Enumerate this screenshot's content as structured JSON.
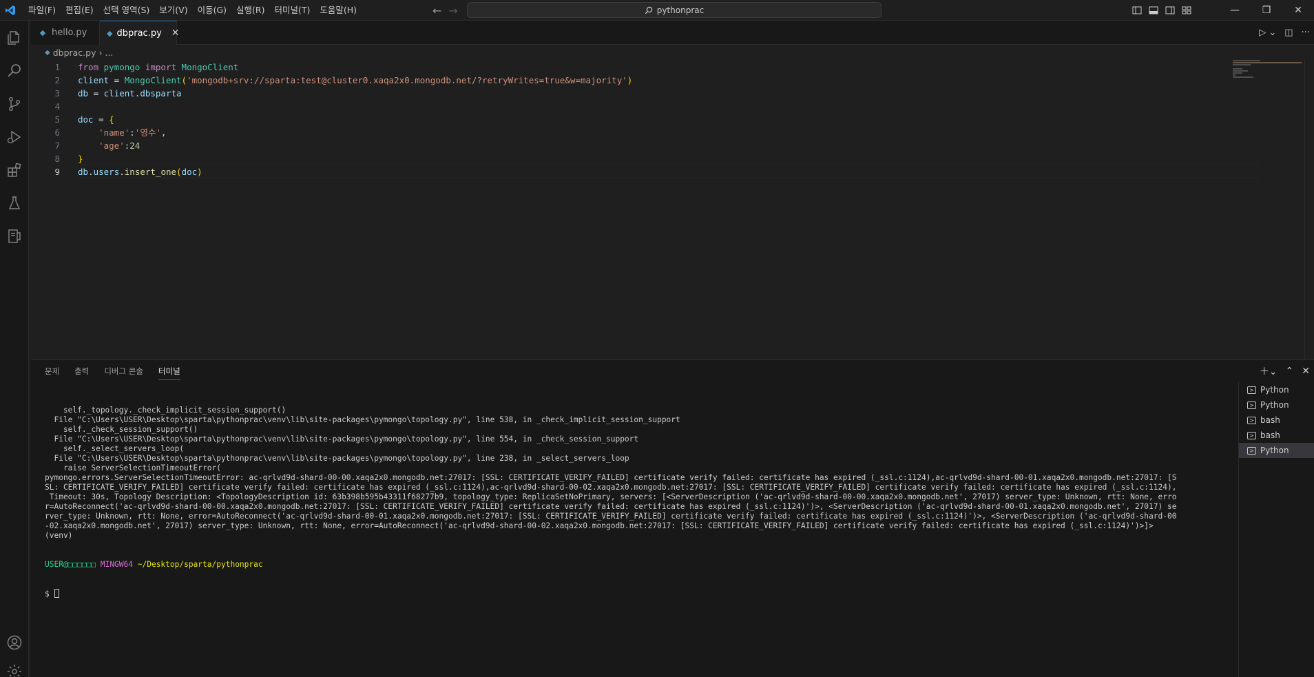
{
  "menu": [
    "파일(F)",
    "편집(E)",
    "선택 영역(S)",
    "보기(V)",
    "이동(G)",
    "실행(R)",
    "터미널(T)",
    "도움말(H)"
  ],
  "search": {
    "text": "pythonprac"
  },
  "tabs": [
    {
      "label": "hello.py",
      "active": false
    },
    {
      "label": "dbprac.py",
      "active": true
    }
  ],
  "breadcrumb": {
    "file": "dbprac.py",
    "rest": "..."
  },
  "editor": {
    "line_numbers": [
      "1",
      "2",
      "3",
      "4",
      "5",
      "6",
      "7",
      "8",
      "9"
    ],
    "lines": [
      [
        {
          "t": "from",
          "c": "kw"
        },
        {
          "t": " "
        },
        {
          "t": "pymongo",
          "c": "mod"
        },
        {
          "t": " "
        },
        {
          "t": "import",
          "c": "kw"
        },
        {
          "t": " "
        },
        {
          "t": "MongoClient",
          "c": "mod"
        }
      ],
      [
        {
          "t": "client",
          "c": "var"
        },
        {
          "t": " = ",
          "c": "op"
        },
        {
          "t": "MongoClient",
          "c": "mod"
        },
        {
          "t": "(",
          "c": "br1"
        },
        {
          "t": "'mongodb+srv://sparta:test@cluster0.xaqa2x0.mongodb.net/?retryWrites=true&w=majority'",
          "c": "str"
        },
        {
          "t": ")",
          "c": "br1"
        }
      ],
      [
        {
          "t": "db",
          "c": "var"
        },
        {
          "t": " = ",
          "c": "op"
        },
        {
          "t": "client",
          "c": "var"
        },
        {
          "t": ".",
          "c": "op"
        },
        {
          "t": "dbsparta",
          "c": "var"
        }
      ],
      [],
      [
        {
          "t": "doc",
          "c": "var"
        },
        {
          "t": " = ",
          "c": "op"
        },
        {
          "t": "{",
          "c": "br1"
        }
      ],
      [
        {
          "t": "    "
        },
        {
          "t": "'name'",
          "c": "str"
        },
        {
          "t": ":",
          "c": "op"
        },
        {
          "t": "'영수'",
          "c": "str"
        },
        {
          "t": ",",
          "c": "op"
        }
      ],
      [
        {
          "t": "    "
        },
        {
          "t": "'age'",
          "c": "str"
        },
        {
          "t": ":",
          "c": "op"
        },
        {
          "t": "24",
          "c": "num"
        }
      ],
      [
        {
          "t": "}",
          "c": "br1"
        }
      ],
      [
        {
          "t": "db",
          "c": "var"
        },
        {
          "t": ".",
          "c": "op"
        },
        {
          "t": "users",
          "c": "var"
        },
        {
          "t": ".",
          "c": "op"
        },
        {
          "t": "insert_one",
          "c": "fn"
        },
        {
          "t": "(",
          "c": "br1"
        },
        {
          "t": "doc",
          "c": "var"
        },
        {
          "t": ")",
          "c": "br1"
        }
      ]
    ]
  },
  "panel": {
    "tabs": [
      {
        "label": "문제",
        "active": false
      },
      {
        "label": "출력",
        "active": false
      },
      {
        "label": "디버그 콘솔",
        "active": false
      },
      {
        "label": "터미널",
        "active": true
      }
    ],
    "terminal_lines": [
      "    self._topology._check_implicit_session_support()",
      "  File \"C:\\Users\\USER\\Desktop\\sparta\\pythonprac\\venv\\lib\\site-packages\\pymongo\\topology.py\", line 538, in _check_implicit_session_support",
      "    self._check_session_support()",
      "  File \"C:\\Users\\USER\\Desktop\\sparta\\pythonprac\\venv\\lib\\site-packages\\pymongo\\topology.py\", line 554, in _check_session_support",
      "    self._select_servers_loop(",
      "  File \"C:\\Users\\USER\\Desktop\\sparta\\pythonprac\\venv\\lib\\site-packages\\pymongo\\topology.py\", line 238, in _select_servers_loop",
      "    raise ServerSelectionTimeoutError(",
      "pymongo.errors.ServerSelectionTimeoutError: ac-qrlvd9d-shard-00-00.xaqa2x0.mongodb.net:27017: [SSL: CERTIFICATE_VERIFY_FAILED] certificate verify failed: certificate has expired (_ssl.c:1124),ac-qrlvd9d-shard-00-01.xaqa2x0.mongodb.net:27017: [S",
      "SL: CERTIFICATE_VERIFY_FAILED] certificate verify failed: certificate has expired (_ssl.c:1124),ac-qrlvd9d-shard-00-02.xaqa2x0.mongodb.net:27017: [SSL: CERTIFICATE_VERIFY_FAILED] certificate verify failed: certificate has expired (_ssl.c:1124),",
      " Timeout: 30s, Topology Description: <TopologyDescription id: 63b398b595b43311f68277b9, topology_type: ReplicaSetNoPrimary, servers: [<ServerDescription ('ac-qrlvd9d-shard-00-00.xaqa2x0.mongodb.net', 27017) server_type: Unknown, rtt: None, erro",
      "r=AutoReconnect('ac-qrlvd9d-shard-00-00.xaqa2x0.mongodb.net:27017: [SSL: CERTIFICATE_VERIFY_FAILED] certificate verify failed: certificate has expired (_ssl.c:1124)')>, <ServerDescription ('ac-qrlvd9d-shard-00-01.xaqa2x0.mongodb.net', 27017) se",
      "rver_type: Unknown, rtt: None, error=AutoReconnect('ac-qrlvd9d-shard-00-01.xaqa2x0.mongodb.net:27017: [SSL: CERTIFICATE_VERIFY_FAILED] certificate verify failed: certificate has expired (_ssl.c:1124)')>, <ServerDescription ('ac-qrlvd9d-shard-00",
      "-02.xaqa2x0.mongodb.net', 27017) server_type: Unknown, rtt: None, error=AutoReconnect('ac-qrlvd9d-shard-00-02.xaqa2x0.mongodb.net:27017: [SSL: CERTIFICATE_VERIFY_FAILED] certificate verify failed: certificate has expired (_ssl.c:1124)')>]>",
      "(venv)"
    ],
    "prompt": {
      "user": "USER@□□□□□□",
      "shell": "MINGW64",
      "path": "~/Desktop/sparta/pythonprac",
      "symbol": "$"
    },
    "terminals": [
      {
        "label": "Python",
        "active": false
      },
      {
        "label": "Python",
        "active": false
      },
      {
        "label": "bash",
        "active": false
      },
      {
        "label": "bash",
        "active": false
      },
      {
        "label": "Python",
        "active": true
      }
    ]
  },
  "colors": {
    "accent": "#0078d4",
    "background": "#1f1f1f",
    "sidebar": "#181818"
  }
}
